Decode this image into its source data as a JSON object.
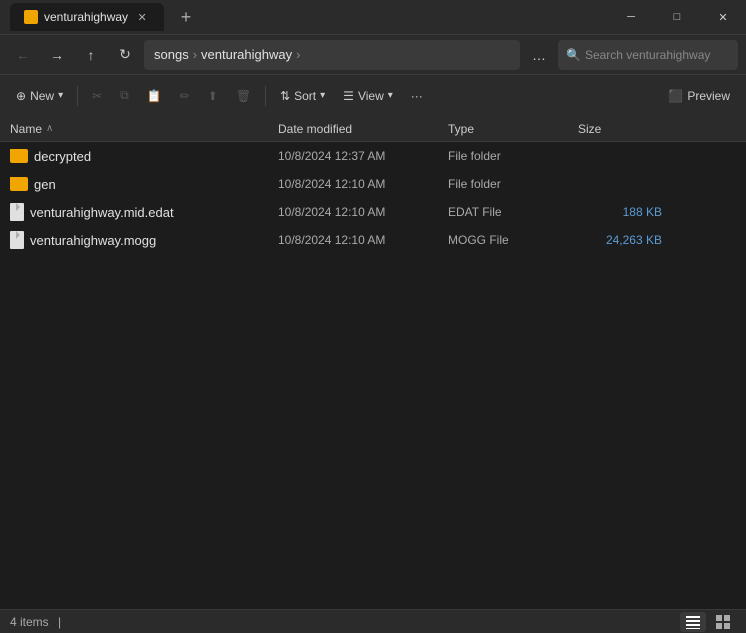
{
  "titlebar": {
    "tab_title": "venturahighway",
    "new_tab_label": "+",
    "min_btn": "─",
    "max_btn": "□",
    "close_btn": "✕"
  },
  "navbar": {
    "back_btn": "←",
    "forward_btn": "→",
    "up_btn": "↑",
    "refresh_btn": "↻",
    "breadcrumb": [
      "songs",
      "venturahighway"
    ],
    "expand_btn": "…",
    "search_placeholder": "Search venturahighway"
  },
  "toolbar": {
    "new_btn": "New",
    "cut_icon": "✂",
    "copy_icon": "⧉",
    "paste_icon": "⬜",
    "rename_icon": "✏",
    "share_icon": "⬆",
    "delete_icon": "🗑",
    "sort_btn": "Sort",
    "view_btn": "View",
    "more_btn": "···",
    "preview_btn": "Preview"
  },
  "list_header": {
    "name_col": "Name",
    "sort_indicator": "∧",
    "date_col": "Date modified",
    "type_col": "Type",
    "size_col": "Size"
  },
  "files": [
    {
      "name": "decrypted",
      "type_icon": "folder",
      "date": "10/8/2024 12:37 AM",
      "file_type": "File folder",
      "size": ""
    },
    {
      "name": "gen",
      "type_icon": "folder",
      "date": "10/8/2024 12:10 AM",
      "file_type": "File folder",
      "size": ""
    },
    {
      "name": "venturahighway.mid.edat",
      "type_icon": "file",
      "date": "10/8/2024 12:10 AM",
      "file_type": "EDAT File",
      "size": "188 KB"
    },
    {
      "name": "venturahighway.mogg",
      "type_icon": "file",
      "date": "10/8/2024 12:10 AM",
      "file_type": "MOGG File",
      "size": "24,263 KB"
    }
  ],
  "statusbar": {
    "item_count": "4 items",
    "separator": "|"
  }
}
